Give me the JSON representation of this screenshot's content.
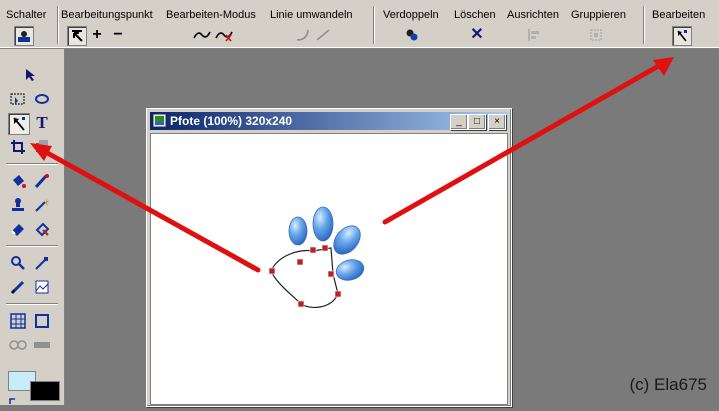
{
  "toolbar": {
    "groups": [
      {
        "label": "Schalter"
      },
      {
        "label": "Bearbeitungspunkt"
      },
      {
        "label": "Bearbeiten-Modus"
      },
      {
        "label": "Linie umwandeln"
      },
      {
        "label": "Verdoppeln"
      },
      {
        "label": "Löschen"
      },
      {
        "label": "Ausrichten"
      },
      {
        "label": "Gruppieren"
      },
      {
        "label": "Bearbeiten"
      }
    ]
  },
  "document_window": {
    "title": "Pfote (100%) 320x240",
    "buttons": {
      "minimize": "_",
      "maximize": "□",
      "close": "×"
    }
  },
  "credit": "(c) Ela675",
  "colors": {
    "foreground_swatch": "#c8ecf8",
    "background_swatch": "#000000",
    "arrow": "#e01010",
    "paw_blue": "#6aa8ec"
  }
}
